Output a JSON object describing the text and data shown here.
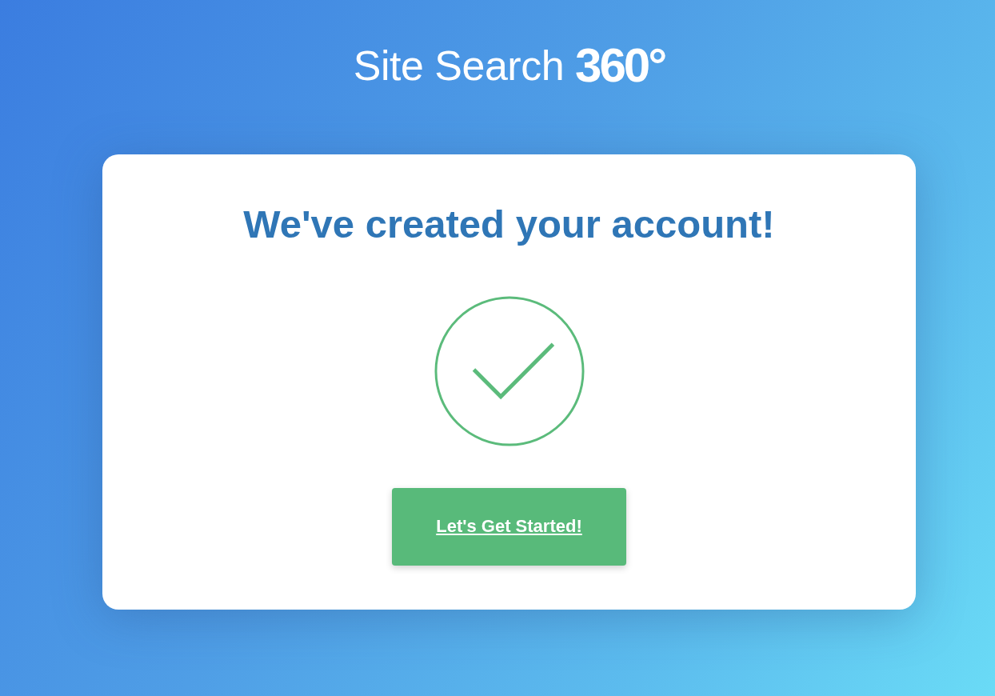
{
  "logo": {
    "wordmark": "Site Search",
    "number": "360°"
  },
  "card": {
    "heading": "We've created your account!",
    "button": "Let's Get Started!"
  }
}
